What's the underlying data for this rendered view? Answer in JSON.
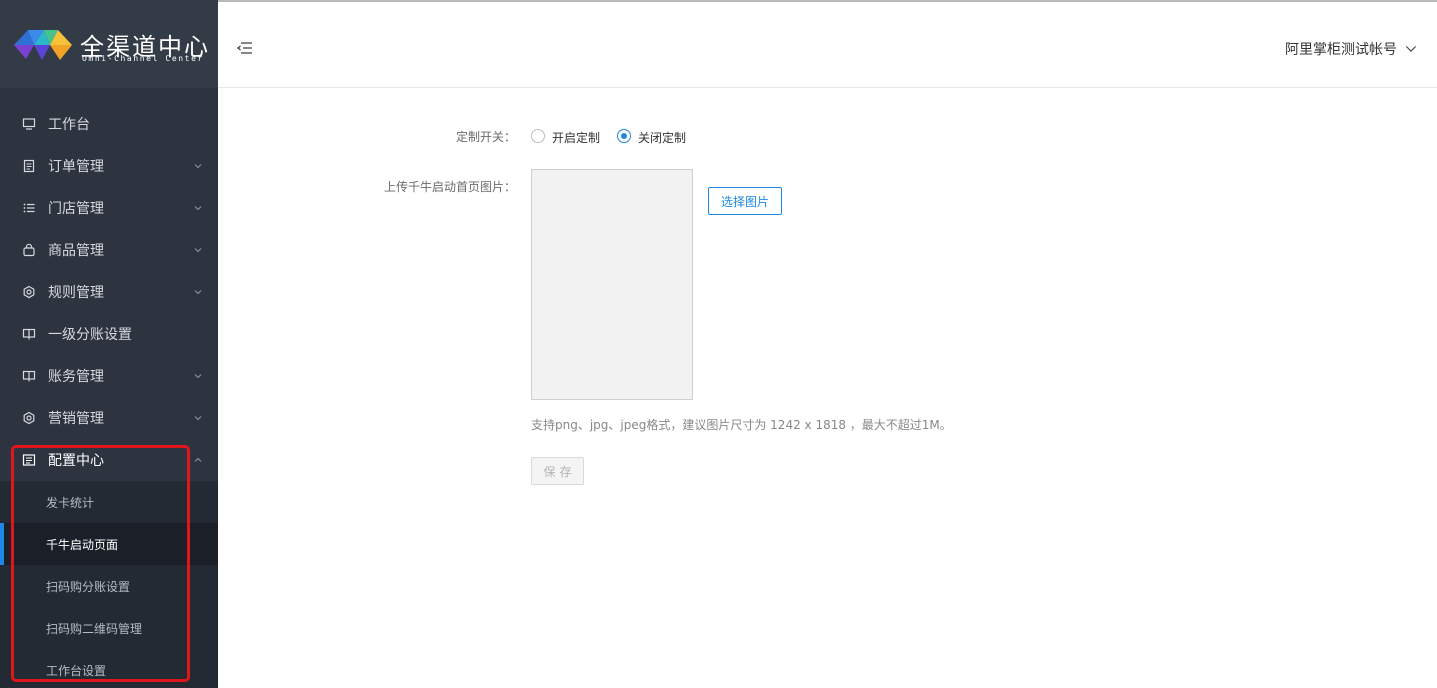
{
  "brand": {
    "title": "全渠道中心",
    "subtitle": "Omni-Channel Center"
  },
  "sidebar": {
    "items": [
      {
        "label": "工作台",
        "icon": "monitor-icon"
      },
      {
        "label": "订单管理",
        "icon": "document-icon"
      },
      {
        "label": "门店管理",
        "icon": "list-icon"
      },
      {
        "label": "商品管理",
        "icon": "bag-icon"
      },
      {
        "label": "规则管理",
        "icon": "gear-icon"
      },
      {
        "label": "一级分账设置",
        "icon": "split-icon"
      },
      {
        "label": "账务管理",
        "icon": "split-icon"
      },
      {
        "label": "营销管理",
        "icon": "gear-icon"
      },
      {
        "label": "配置中心",
        "icon": "config-icon"
      }
    ],
    "config_children": [
      {
        "label": "发卡统计"
      },
      {
        "label": "千牛启动页面"
      },
      {
        "label": "扫码购分账设置"
      },
      {
        "label": "扫码购二维码管理"
      },
      {
        "label": "工作台设置"
      }
    ],
    "active_child_index": 1
  },
  "header": {
    "account_name": "阿里掌柜测试帐号"
  },
  "form": {
    "switch_label": "定制开关：",
    "options": [
      {
        "label": "开启定制",
        "checked": false
      },
      {
        "label": "关闭定制",
        "checked": true
      }
    ],
    "upload_label": "上传千牛启动首页图片：",
    "select_image_label": "选择图片",
    "hint": "支持png、jpg、jpeg格式，建议图片尺寸为 1242 x 1818 ，最大不超过1M。",
    "save_label": "保存"
  },
  "colors": {
    "sidebar_bg": "#2d3440",
    "accent": "#1e88e5",
    "highlight": "#e0161b"
  }
}
